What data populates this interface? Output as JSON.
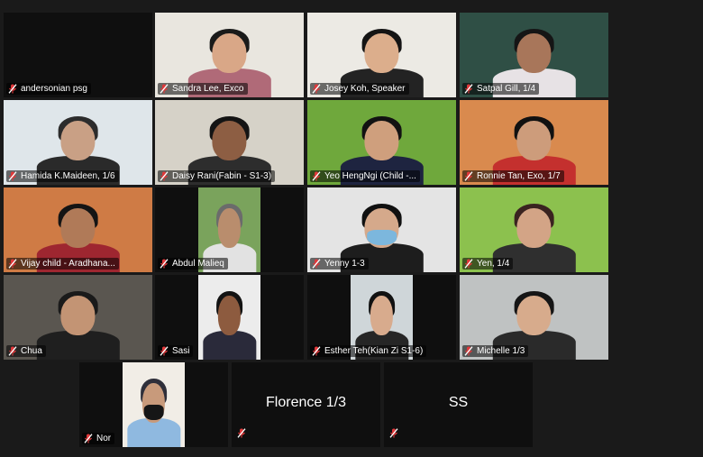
{
  "participants": [
    {
      "name": "andersonian psg",
      "video": "none"
    },
    {
      "name": "Sandra Lee, Exco",
      "video": "person",
      "bg": "#e9e6df",
      "shirt": "#b06a78",
      "skin": "#d9a787",
      "hair": "#1a1a1a"
    },
    {
      "name": "Josey Koh, Speaker",
      "video": "person",
      "bg": "#eceae4",
      "shirt": "#232323",
      "skin": "#dcae8c",
      "hair": "#141414",
      "active": true
    },
    {
      "name": "Satpal Gill, 1/4",
      "video": "person",
      "bg": "#2f4f45",
      "shirt": "#e7e2e5",
      "skin": "#a8765a",
      "hair": "#151515"
    },
    {
      "name": "Hamida K.Maideen, 1/6",
      "video": "person",
      "bg": "#dfe6ea",
      "shirt": "#2a2a2a",
      "skin": "#c9a085",
      "hair": "#2c2c2c"
    },
    {
      "name": "Daisy Rani(Fabin - S1-3)",
      "video": "person",
      "bg": "#d6d2c8",
      "shirt": "#2d2d2d",
      "skin": "#8d5e43",
      "hair": "#141414"
    },
    {
      "name": "Yeo HengNgi (Child -...",
      "video": "person",
      "bg": "#6fa83c",
      "shirt": "#1e2440",
      "skin": "#cf9f7d",
      "hair": "#121212"
    },
    {
      "name": "Ronnie Tan, Exo, 1/7",
      "video": "person",
      "bg": "#d98a4e",
      "shirt": "#c4302e",
      "skin": "#cd9c7b",
      "hair": "#111111"
    },
    {
      "name": "Vijay  child - Aradhana...",
      "video": "person",
      "bg": "#cf7b45",
      "shirt": "#9e2630",
      "skin": "#b07a58",
      "hair": "#141414"
    },
    {
      "name": "Abdul Malieq",
      "video": "narrow",
      "bg": "#7aa35c",
      "shirt": "#e2e2e2",
      "skin": "#b98d6d",
      "hair": "#6b6b6b"
    },
    {
      "name": "Yenny 1-3",
      "video": "person",
      "bg": "#e4e4e4",
      "shirt": "#1d1d1d",
      "skin": "#d5a98b",
      "hair": "#101010",
      "mask": "#7cb7dd"
    },
    {
      "name": "Yen, 1/4",
      "video": "person",
      "bg": "#8cc14e",
      "shirt": "#2f2f2f",
      "skin": "#d3a486",
      "hair": "#3a2320"
    },
    {
      "name": "Chua",
      "video": "person",
      "bg": "#5a5650",
      "shirt": "#1f1f1f",
      "skin": "#c39474",
      "hair": "#1a1a1a"
    },
    {
      "name": "Sasi",
      "video": "narrow",
      "bg": "#ececec",
      "shirt": "#2a2a3a",
      "skin": "#8d5b3f",
      "hair": "#131313"
    },
    {
      "name": "Esther Teh(Kian Zi S1-6)",
      "video": "narrow",
      "bg": "#cfd6d9",
      "shirt": "#262626",
      "skin": "#d8ab8d",
      "hair": "#111111"
    },
    {
      "name": "Michelle 1/3",
      "video": "person",
      "bg": "#bfc2c2",
      "shirt": "#2a2a2a",
      "skin": "#d7ab8c",
      "hair": "#151515"
    },
    {
      "name": "Nor",
      "video": "narrow",
      "bg": "#f1ede6",
      "shirt": "#8fb9e0",
      "skin": "#c89a7b",
      "hair": "#2f2f3a",
      "mask": "#161616"
    },
    {
      "name": "Florence 1/3",
      "video": "none",
      "center": true
    },
    {
      "name": "SS",
      "video": "none",
      "center": true
    }
  ],
  "colors": {
    "mic_muted": "#e0383a",
    "active_border": "#e8d84a"
  }
}
